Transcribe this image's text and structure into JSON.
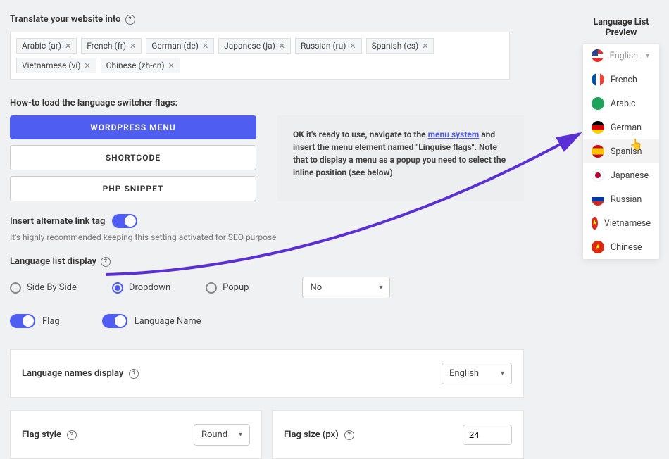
{
  "sections": {
    "translate_label": "Translate your website into",
    "loader_label": "How-to load the language switcher flags:",
    "alt_link_label": "Insert alternate link tag",
    "alt_link_hint": "It's highly recommended keeping this setting activated for SEO purpose",
    "list_display_label": "Language list display",
    "names_display_label": "Language names display",
    "flag_style_label": "Flag style",
    "flag_size_label": "Flag size (px)"
  },
  "chips": [
    "Arabic (ar)",
    "French (fr)",
    "German (de)",
    "Japanese (ja)",
    "Russian (ru)",
    "Spanish (es)",
    "Vietnamese (vi)",
    "Chinese (zh-cn)"
  ],
  "loader_buttons": {
    "wordpress": "WORDPRESS MENU",
    "shortcode": "SHORTCODE",
    "php": "PHP SNIPPET"
  },
  "info": {
    "pre": "OK it's ready to use, navigate to the ",
    "link": "menu system",
    "post": " and insert the menu element named \"Linguise flags\". Note that to display a menu as a popup you need to select the inline position (see below)"
  },
  "radios": {
    "side": "Side By Side",
    "dropdown": "Dropdown",
    "popup": "Popup"
  },
  "select_no": {
    "value": "No"
  },
  "toggles": {
    "flag": "Flag",
    "lang_name": "Language Name"
  },
  "names_display_value": "English",
  "flag_style_value": "Round",
  "flag_size_value": "24",
  "preview": {
    "title": "Language List Preview",
    "items": [
      {
        "label": "English",
        "flag": "us",
        "header": true
      },
      {
        "label": "French",
        "flag": "fr"
      },
      {
        "label": "Arabic",
        "flag": "ar"
      },
      {
        "label": "German",
        "flag": "de"
      },
      {
        "label": "Spanish",
        "flag": "es",
        "hover": true
      },
      {
        "label": "Japanese",
        "flag": "jp"
      },
      {
        "label": "Russian",
        "flag": "ru"
      },
      {
        "label": "Vietnamese",
        "flag": "vn"
      },
      {
        "label": "Chinese",
        "flag": "cn"
      }
    ]
  }
}
